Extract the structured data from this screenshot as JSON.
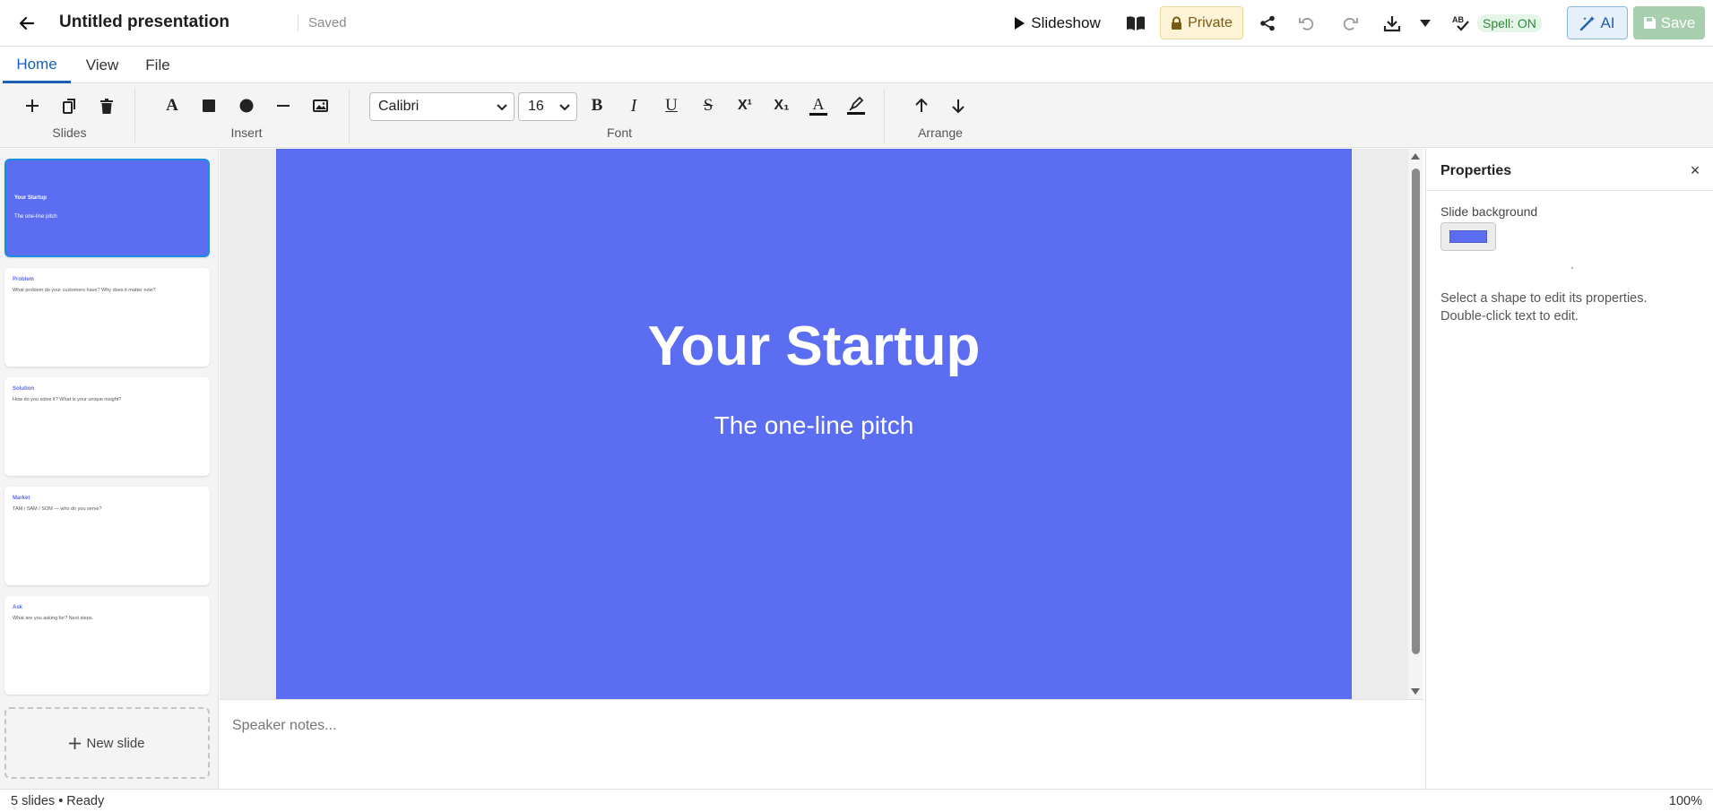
{
  "header": {
    "title": "Untitled presentation",
    "saved_status": "Saved",
    "slideshow_label": "Slideshow",
    "private_label": "Private",
    "spell_label": "Spell: ON",
    "ai_label": "AI",
    "save_label": "Save"
  },
  "tabs": [
    {
      "label": "Home",
      "active": true
    },
    {
      "label": "View",
      "active": false
    },
    {
      "label": "File",
      "active": false
    }
  ],
  "ribbon": {
    "groups": {
      "slides": "Slides",
      "insert": "Insert",
      "font": "Font",
      "arrange": "Arrange"
    },
    "font_family": "Calibri",
    "font_size": "16",
    "icons": {
      "text": "A",
      "bold": "B",
      "italic": "I",
      "underline": "U",
      "strike": "S",
      "superscript": "X¹",
      "subscript": "X₁",
      "text_color": "A"
    }
  },
  "slides": [
    {
      "title": "Your Startup",
      "body": "The one-line pitch",
      "active": true
    },
    {
      "title": "Problem",
      "body": "What problem do your customers have? Why does it matter now?",
      "active": false
    },
    {
      "title": "Solution",
      "body": "How do you solve it? What is your unique insight?",
      "active": false
    },
    {
      "title": "Market",
      "body": "TAM / SAM / SOM — who do you serve?",
      "active": false
    },
    {
      "title": "Ask",
      "body": "What are you asking for? Next steps.",
      "active": false
    }
  ],
  "new_slide_label": "New slide",
  "canvas": {
    "title": "Your Startup",
    "subtitle": "The one-line pitch",
    "background_color": "#5b6df0"
  },
  "notes": {
    "placeholder": "Speaker notes..."
  },
  "properties": {
    "title": "Properties",
    "close_icon": "×",
    "bg_label": "Slide background",
    "hint_line1": "Select a shape to edit its properties.",
    "hint_line2": "Double-click text to edit."
  },
  "status": {
    "summary": "5 slides • Ready",
    "zoom": "100%"
  },
  "colors": {
    "accent": "#1a5fb4",
    "slide_bg": "#5b6df0",
    "save_btn": "#a7cfae",
    "private_bg": "#fdf3d6"
  }
}
